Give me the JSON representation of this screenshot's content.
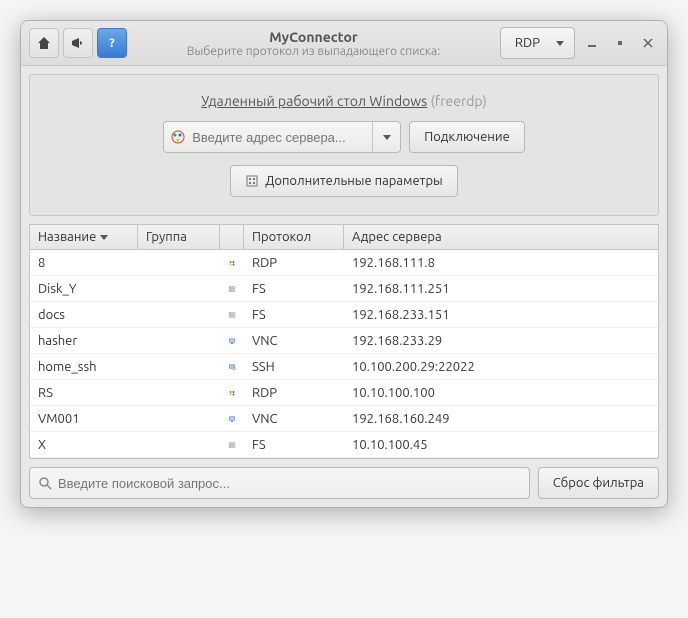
{
  "titlebar": {
    "title": "MyConnector",
    "subtitle": "Выберите протокол из выпадающего списка:",
    "protocol_selected": "RDP"
  },
  "panel": {
    "headline_link": "Удаленный рабочий стол Windows",
    "headline_dim": "(freerdp)",
    "address_placeholder": "Введите адрес сервера...",
    "connect_label": "Подключение",
    "advanced_label": "Дополнительные параметры"
  },
  "columns": {
    "name": "Название",
    "group": "Группа",
    "protocol": "Протокол",
    "address": "Адрес сервера"
  },
  "rows": [
    {
      "name": "8",
      "group": "",
      "icon": "rdp",
      "protocol": "RDP",
      "address": "192.168.111.8"
    },
    {
      "name": "Disk_Y",
      "group": "",
      "icon": "fs",
      "protocol": "FS",
      "address": "192.168.111.251"
    },
    {
      "name": "docs",
      "group": "",
      "icon": "fs",
      "protocol": "FS",
      "address": "192.168.233.151"
    },
    {
      "name": "hasher",
      "group": "",
      "icon": "vnc",
      "protocol": "VNC",
      "address": "192.168.233.29"
    },
    {
      "name": "home_ssh",
      "group": "",
      "icon": "ssh",
      "protocol": "SSH",
      "address": "10.100.200.29:22022"
    },
    {
      "name": "RS",
      "group": "",
      "icon": "rdp",
      "protocol": "RDP",
      "address": "10.10.100.100"
    },
    {
      "name": "VM001",
      "group": "",
      "icon": "vnc",
      "protocol": "VNC",
      "address": "192.168.160.249"
    },
    {
      "name": "X",
      "group": "",
      "icon": "fs",
      "protocol": "FS",
      "address": "10.10.100.45"
    }
  ],
  "footer": {
    "search_placeholder": "Введите поисковой запрос...",
    "reset_label": "Сброс фильтра"
  },
  "icons": {
    "rdp_color": "#d94f2a",
    "vnc_color": "#4a7db5",
    "fs_color": "#8a8a88",
    "ssh_color": "#c9a227"
  }
}
